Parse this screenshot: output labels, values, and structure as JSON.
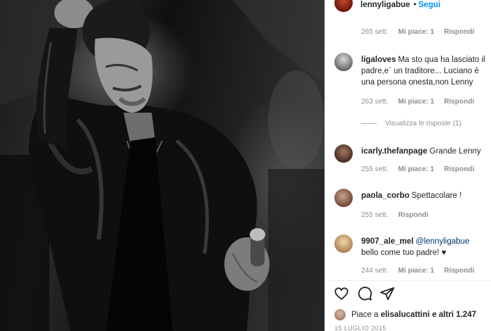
{
  "post": {
    "author": "lennyligabue",
    "separator": "•",
    "follow_label": "Segui"
  },
  "comments": [
    {
      "username": "",
      "text": "",
      "time": "265 sett.",
      "likes": "Mi piace: 1",
      "reply_label": "Rispondi"
    },
    {
      "username": "ligaloves",
      "text": "Ma sto qua ha lasciato il padre,e` un traditore... Luciano è una persona onesta,non Lenny",
      "time": "263 sett.",
      "likes": "Mi piace: 1",
      "reply_label": "Rispondi"
    },
    {
      "username": "icarly.thefanpage",
      "text": "Grande Lenny",
      "time": "255 sett.",
      "likes": "Mi piace: 1",
      "reply_label": "Rispondi"
    },
    {
      "username": "paola_corbo",
      "text": "Spettacolare !",
      "time": "255 sett.",
      "reply_label": "Rispondi"
    },
    {
      "username": "9907_ale_mel",
      "mention": "@lennyligabue",
      "text": "bello come tuo padre! ♥",
      "time": "244 sett.",
      "likes": "Mi piace: 1",
      "reply_label": "Rispondi"
    }
  ],
  "view_replies_label": "Visualizza le risposte (1)",
  "actions": {
    "icons": [
      "heart-icon",
      "comment-icon",
      "share-icon"
    ],
    "likes_prefix": "Piace a",
    "likes_user": "elisalucattini",
    "likes_suffix": "e altri",
    "likes_count": "1.247",
    "date": "15 LUGLIO 2015"
  }
}
